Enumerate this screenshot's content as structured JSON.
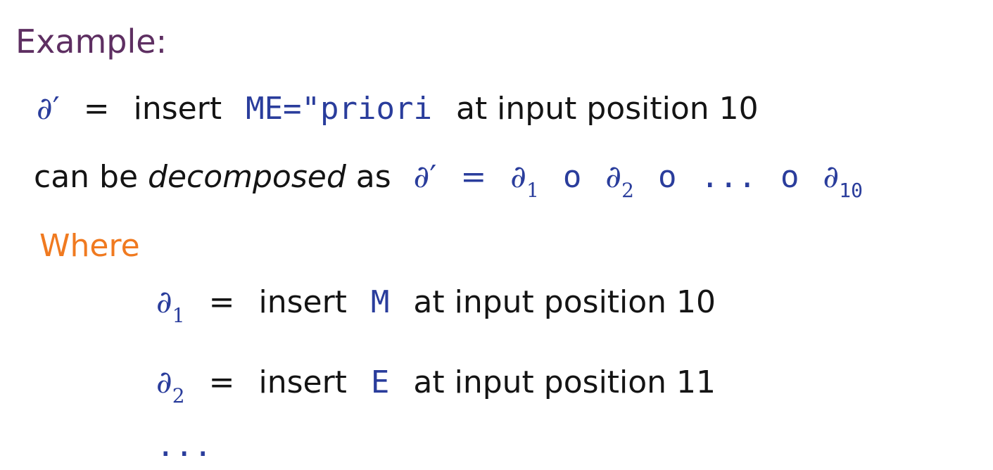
{
  "title": "Example:",
  "line1": {
    "symbol": "∂′",
    "eq": "=",
    "verb": "insert",
    "code": "ME=\"priori",
    "rest": "at input position 10"
  },
  "line2": {
    "prefix": "can be",
    "italic": "decomposed",
    "as": "as",
    "expr": {
      "lhs": "∂′",
      "eq": "=",
      "d": "∂",
      "sub1": "1",
      "o1": "o",
      "sub2": "2",
      "o2": "o",
      "dots": "...",
      "o3": "o",
      "sub10": "10"
    }
  },
  "where": "Where",
  "line3": {
    "d": "∂",
    "sub": "1",
    "eq": "=",
    "verb": "insert",
    "code": "M",
    "rest": "at input position 10"
  },
  "line4": {
    "d": "∂",
    "sub": "2",
    "eq": "=",
    "verb": "insert",
    "code": "E",
    "rest": "at input position 11"
  },
  "ellipsis": "..."
}
